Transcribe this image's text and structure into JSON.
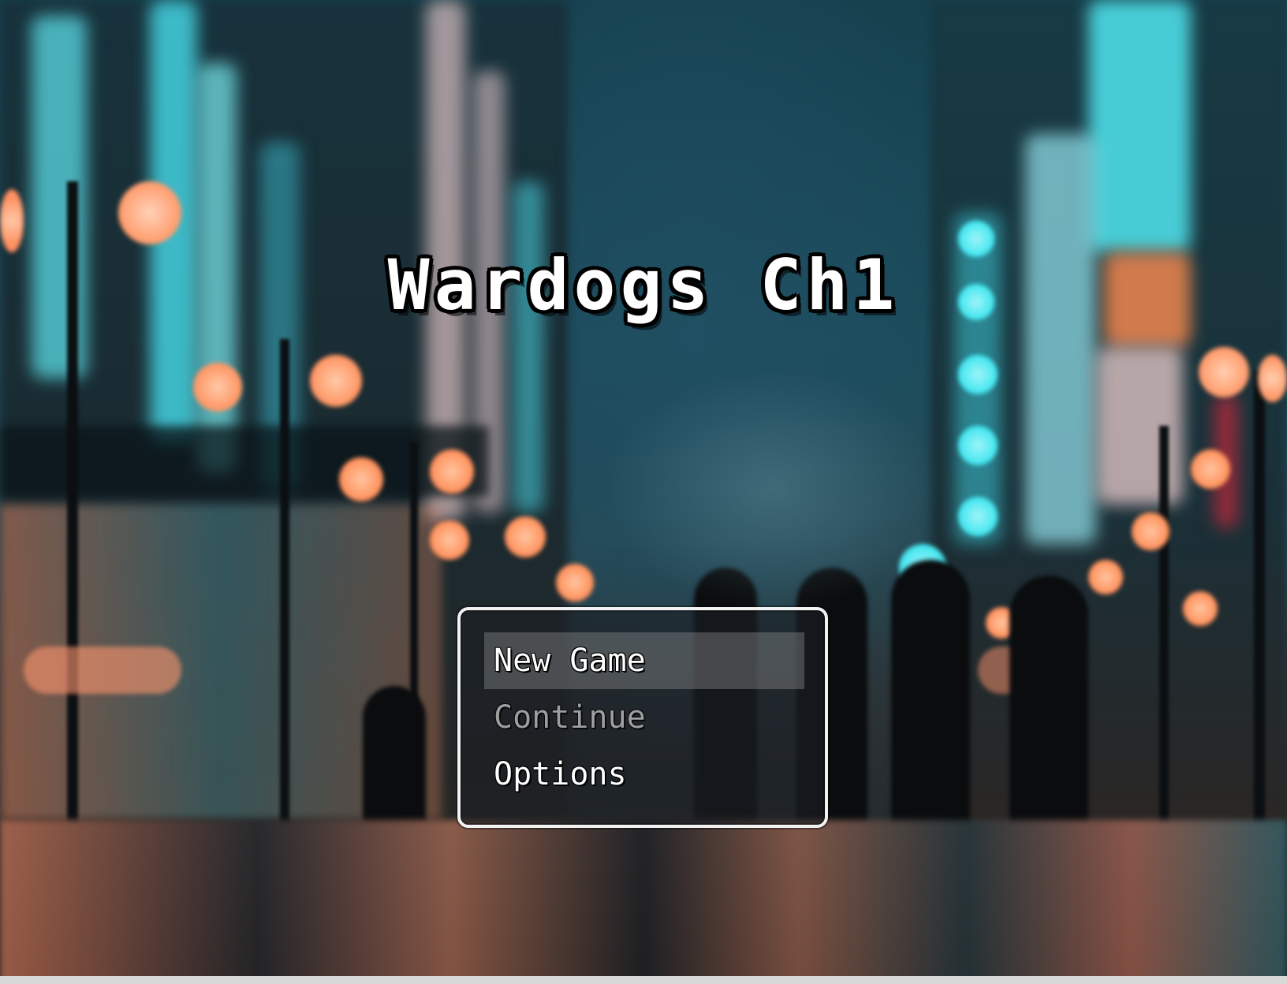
{
  "title": {
    "text": "Wardogs Ch1"
  },
  "menu": {
    "items": [
      {
        "label": "New Game",
        "state": "selected"
      },
      {
        "label": "Continue",
        "state": "disabled"
      },
      {
        "label": "Options",
        "state": "enabled"
      }
    ]
  },
  "colors": {
    "title_text": "#ffffff",
    "title_outline": "#000000",
    "window_border": "#f2f2f2",
    "window_fill": "#1c1e24",
    "selection_highlight": "#969696",
    "disabled_text": "#c8c8c8",
    "neon_cyan": "#3ee6f0",
    "lamp_orange": "#ff9a6a"
  },
  "background": {
    "scene": "neon-city-street-night"
  }
}
